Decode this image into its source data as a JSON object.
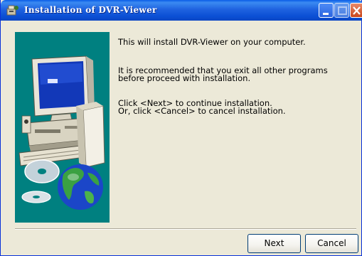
{
  "window": {
    "title": "Installation of DVR-Viewer"
  },
  "message": {
    "line1": "This will install DVR-Viewer on your computer.",
    "line2": "It is recommended that you exit all other programs",
    "line3": "before proceed with installation.",
    "line4": "Click <Next> to continue installation.",
    "line5": "Or, click <Cancel> to cancel installation."
  },
  "buttons": {
    "next": "Next",
    "cancel": "Cancel"
  },
  "colors": {
    "titlebar": "#0a4fd4",
    "panel": "#008080",
    "dialog_bg": "#ece9d8"
  },
  "icons": {
    "app": "installer-app-icon",
    "illustration": "computer-and-cd-globe-illustration"
  }
}
